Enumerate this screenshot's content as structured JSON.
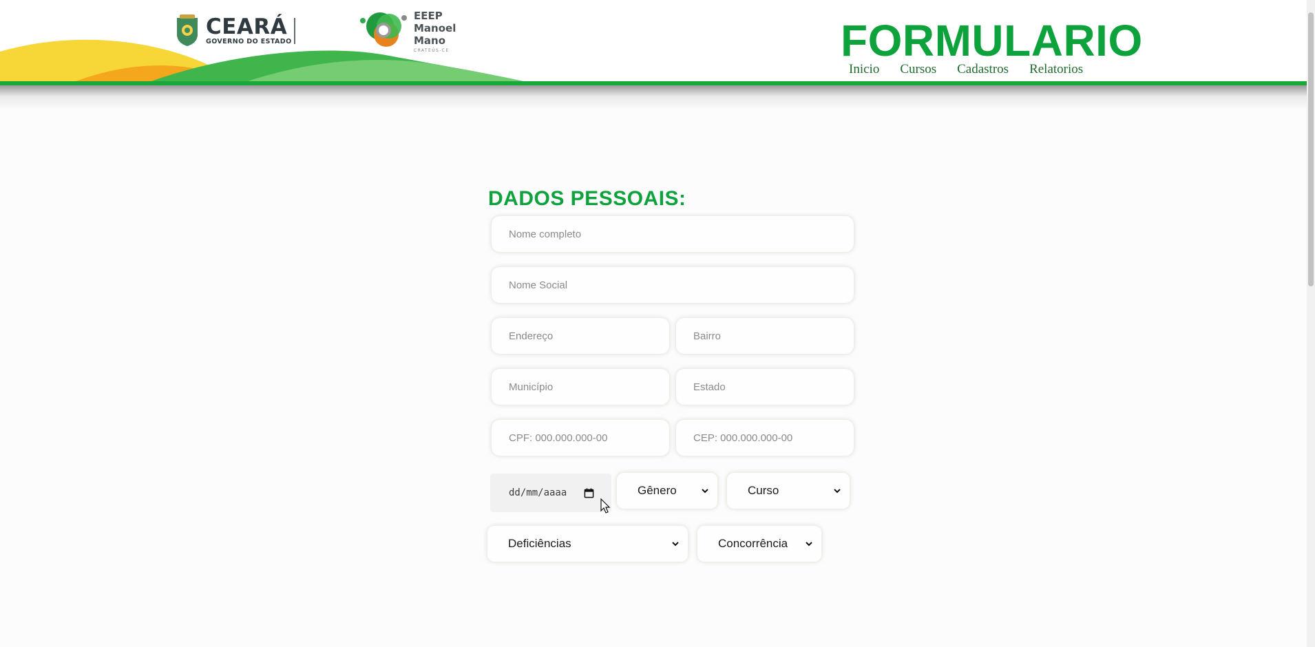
{
  "header": {
    "ceara_logo": {
      "name": "CEARÁ",
      "subtitle": "GOVERNO DO ESTADO"
    },
    "school_logo": {
      "lines": [
        "EEEP",
        "Manoel",
        "Mano"
      ],
      "small_text": "CRATEÚS-CE"
    },
    "title": "FORMULARIO",
    "nav": [
      "Inicio",
      "Cursos",
      "Cadastros",
      "Relatorios"
    ]
  },
  "form": {
    "section_title": "DADOS PESSOAIS:",
    "placeholders": {
      "nome_completo": "Nome completo",
      "nome_social": "Nome Social",
      "endereco": "Endereço",
      "bairro": "Bairro",
      "municipio": "Município",
      "estado": "Estado",
      "cpf": "CPF: 000.000.000-00",
      "cep": "CEP: 000.000.000-00"
    },
    "date_placeholder": "dd/mm/aaaa",
    "selects": {
      "genero": "Gênero",
      "curso": "Curso",
      "deficiencias": "Deficiências",
      "concorrencia": "Concorrência"
    }
  },
  "colors": {
    "accent_green": "#0ea23c",
    "nav_green": "#1f6b2e",
    "bar_green": "#18a83a",
    "wave_yellow": "#f7d637",
    "wave_orange": "#f4a71c"
  },
  "icons": [
    "ceara-crest-icon",
    "eeep-logo-icon",
    "chevron-down-icon",
    "calendar-icon",
    "mouse-cursor-icon"
  ]
}
